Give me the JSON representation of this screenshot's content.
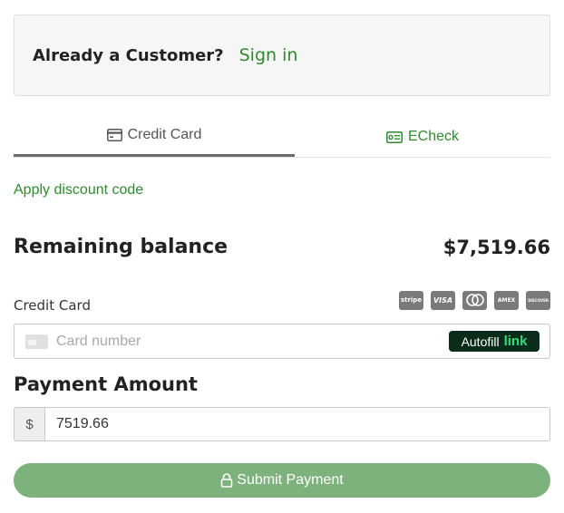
{
  "login": {
    "question": "Already a Customer?",
    "sign_in": "Sign in"
  },
  "tabs": [
    {
      "label": "Credit Card",
      "icon": "credit-card-icon",
      "active": true
    },
    {
      "label": "ECheck",
      "icon": "check-icon",
      "active": false
    }
  ],
  "discount": {
    "label": "Apply discount code"
  },
  "balance": {
    "label": "Remaining balance",
    "value": "$7,519.66"
  },
  "credit_card": {
    "label": "Credit Card",
    "brands": [
      "stripe",
      "VISA",
      "mastercard",
      "AMEX",
      "DISCOVER"
    ],
    "card_placeholder": "Card number",
    "autofill_label": "Autofill",
    "autofill_brand": "link"
  },
  "payment": {
    "title": "Payment Amount",
    "currency_symbol": "$",
    "amount": "7519.66"
  },
  "submit": {
    "label": "Submit Payment"
  },
  "colors": {
    "accent_green": "#2f8a2f",
    "submit_bg": "#7db27d",
    "link_dark": "#0b2c1a",
    "link_green": "#33dd77"
  }
}
